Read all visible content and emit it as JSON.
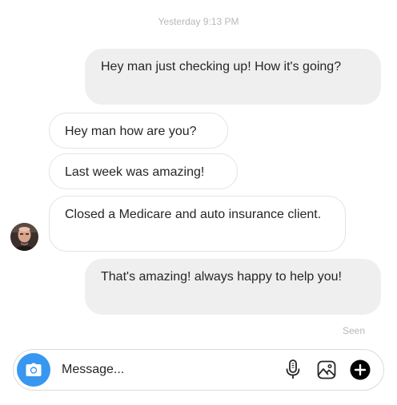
{
  "thread": {
    "timestamp": "Yesterday 9:13 PM",
    "messages": [
      {
        "direction": "outgoing",
        "text": "Hey man just checking up! How it's going?"
      },
      {
        "direction": "incoming",
        "text": "Hey man how are you?"
      },
      {
        "direction": "incoming",
        "text": "Last week was amazing!"
      },
      {
        "direction": "incoming",
        "text": "Closed a Medicare and auto insurance client."
      },
      {
        "direction": "outgoing",
        "text": "That's amazing! always happy to help you!"
      }
    ],
    "seen_label": "Seen"
  },
  "composer": {
    "placeholder": "Message...",
    "icons": [
      "camera-icon",
      "microphone-icon",
      "image-icon",
      "plus-icon"
    ]
  },
  "colors": {
    "accent": "#3897f0",
    "outgoing_bubble": "#efefef",
    "incoming_border": "#e3e3e3",
    "meta_text": "#b8b8b8"
  }
}
